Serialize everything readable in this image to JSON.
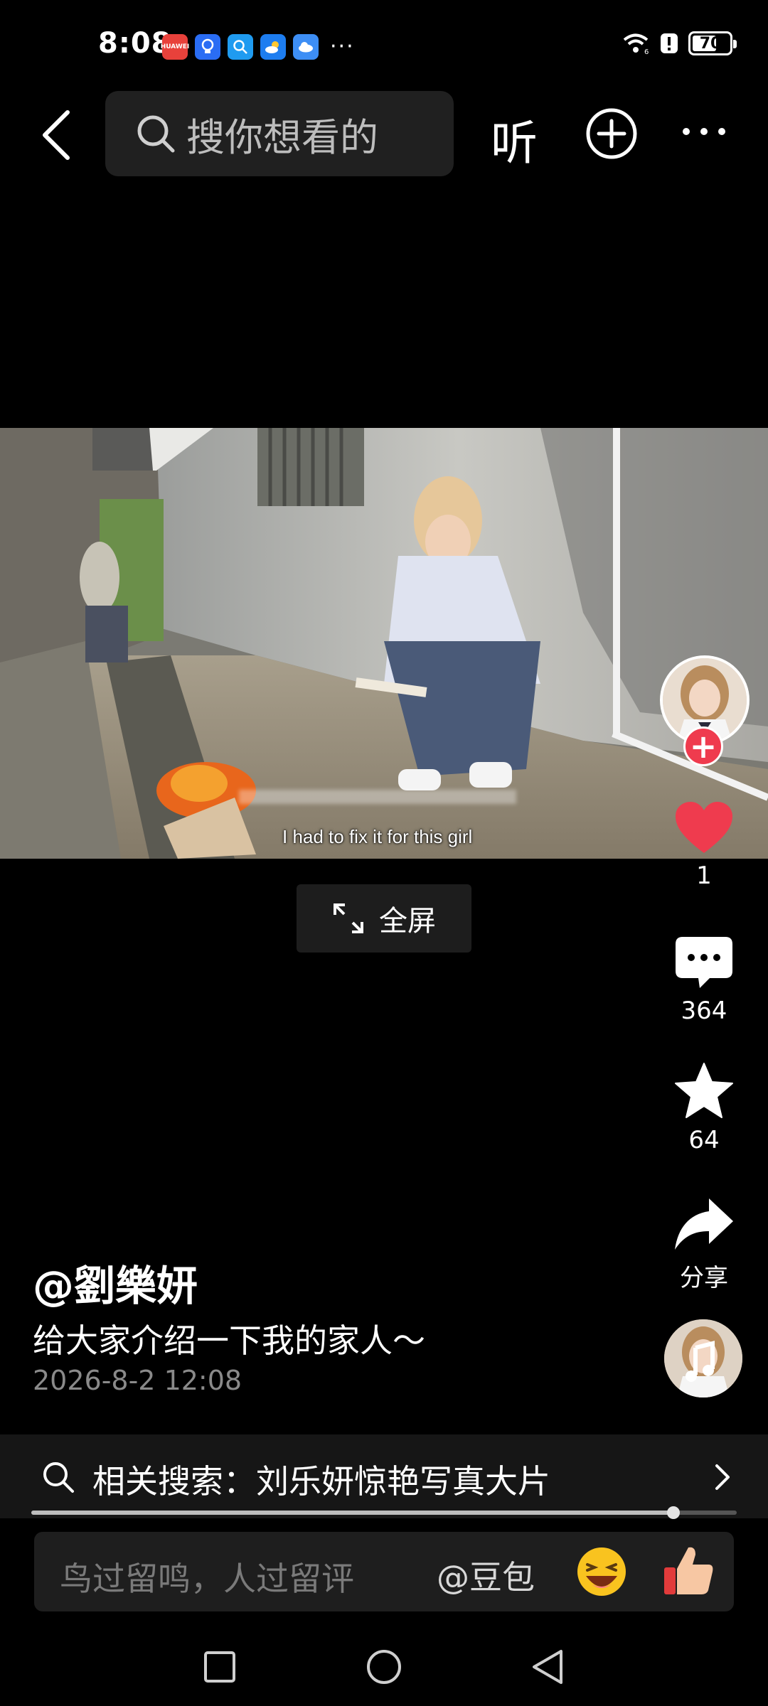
{
  "status_bar": {
    "time": "8:08",
    "app_icons": [
      "huawei-icon",
      "lightbulb-app-icon",
      "search-app-icon",
      "weather-app-icon",
      "cloud-app-icon"
    ],
    "more_indicator": "···",
    "battery": "70",
    "battery_level": 0.7
  },
  "top_bar": {
    "search_placeholder": "搜你想看的",
    "listen_label": "听"
  },
  "video": {
    "subtitle": "I had to fix it for this girl"
  },
  "fullscreen_label": "全屏",
  "rail": {
    "likes": "1",
    "comments": "364",
    "favorites": "64",
    "share_label": "分享"
  },
  "post": {
    "author": "@劉樂妍",
    "description": "给大家介绍一下我的家人～",
    "date": "2026-8-2 12:08"
  },
  "related_search": {
    "label": "相关搜索：刘乐妍惊艳写真大片"
  },
  "progress": 0.91,
  "comment_bar": {
    "placeholder": "鸟过留鸣，人过留评",
    "at_label": "@豆包"
  },
  "colors": {
    "accent_red": "#ef3b4e",
    "background": "#000000"
  }
}
